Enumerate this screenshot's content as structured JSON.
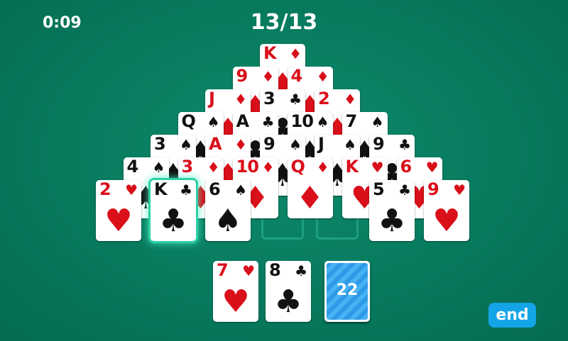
{
  "header": {
    "timer": "0:09",
    "progress": "13/13"
  },
  "pyramid_rows": [
    [
      {
        "rank": "K",
        "suit": "♦",
        "color": "red"
      }
    ],
    [
      {
        "rank": "9",
        "suit": "♦",
        "color": "red"
      },
      {
        "rank": "4",
        "suit": "♦",
        "color": "red"
      }
    ],
    [
      {
        "rank": "J",
        "suit": "♦",
        "color": "red"
      },
      {
        "rank": "3",
        "suit": "♣",
        "color": "black"
      },
      {
        "rank": "2",
        "suit": "♦",
        "color": "red"
      }
    ],
    [
      {
        "rank": "Q",
        "suit": "♠",
        "color": "black"
      },
      {
        "rank": "A",
        "suit": "♣",
        "color": "black"
      },
      {
        "rank": "10",
        "suit": "♠",
        "color": "black"
      },
      {
        "rank": "7",
        "suit": "♠",
        "color": "black"
      }
    ],
    [
      {
        "rank": "3",
        "suit": "♠",
        "color": "black"
      },
      {
        "rank": "A",
        "suit": "♦",
        "color": "red"
      },
      {
        "rank": "9",
        "suit": "♠",
        "color": "black"
      },
      {
        "rank": "J",
        "suit": "♠",
        "color": "black"
      },
      {
        "rank": "9",
        "suit": "♣",
        "color": "black"
      }
    ],
    [
      {
        "rank": "4",
        "suit": "♠",
        "color": "black"
      },
      {
        "rank": "3",
        "suit": "♦",
        "color": "red"
      },
      {
        "rank": "10",
        "suit": "♦",
        "color": "red"
      },
      {
        "rank": "Q",
        "suit": "♦",
        "color": "red"
      },
      {
        "rank": "K",
        "suit": "♥",
        "color": "red"
      },
      {
        "rank": "6",
        "suit": "♥",
        "color": "red"
      }
    ],
    [
      {
        "rank": "2",
        "suit": "♥",
        "color": "red"
      },
      {
        "rank": "K",
        "suit": "♣",
        "color": "black",
        "selected": true
      },
      {
        "rank": "6",
        "suit": "♠",
        "color": "black"
      },
      null,
      null,
      {
        "rank": "5",
        "suit": "♣",
        "color": "black"
      },
      {
        "rank": "9",
        "suit": "♥",
        "color": "red"
      }
    ]
  ],
  "waste": [
    {
      "rank": "7",
      "suit": "♥",
      "color": "red"
    },
    {
      "rank": "8",
      "suit": "♣",
      "color": "black"
    }
  ],
  "stock": {
    "count": "22"
  },
  "buttons": {
    "end": "end"
  },
  "colors": {
    "felt": "#077a5e",
    "red": "#d90f1a",
    "black": "#111111",
    "accent": "#14a4e8",
    "selection_glow": "#2fd0a7"
  }
}
